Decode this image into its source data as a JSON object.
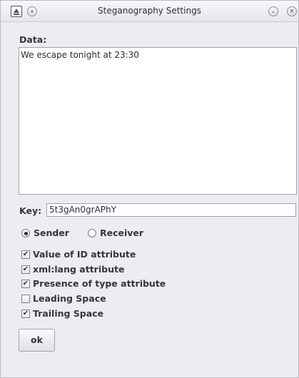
{
  "window": {
    "title": "Steganography Settings",
    "minimize_glyph": "⌄",
    "close_glyph": "×"
  },
  "data_section": {
    "label": "Data:",
    "value": "We escape tonight at 23:30"
  },
  "key_section": {
    "label": "Key:",
    "value": "5t3gAn0grAPhY"
  },
  "mode": {
    "options": [
      {
        "label": "Sender",
        "selected": true
      },
      {
        "label": "Receiver",
        "selected": false
      }
    ]
  },
  "options": [
    {
      "label": "Value of ID attribute",
      "checked": true
    },
    {
      "label": "xml:lang attribute",
      "checked": true
    },
    {
      "label": "Presence of type attribute",
      "checked": true
    },
    {
      "label": "Leading Space",
      "checked": false
    },
    {
      "label": "Trailing Space",
      "checked": true
    }
  ],
  "ok_button": {
    "label": "ok"
  },
  "icons": {
    "app": "app-window-icon",
    "pin": "pin-icon",
    "minimize": "chevron-down-icon",
    "close": "close-icon",
    "check_glyph": "✔"
  }
}
